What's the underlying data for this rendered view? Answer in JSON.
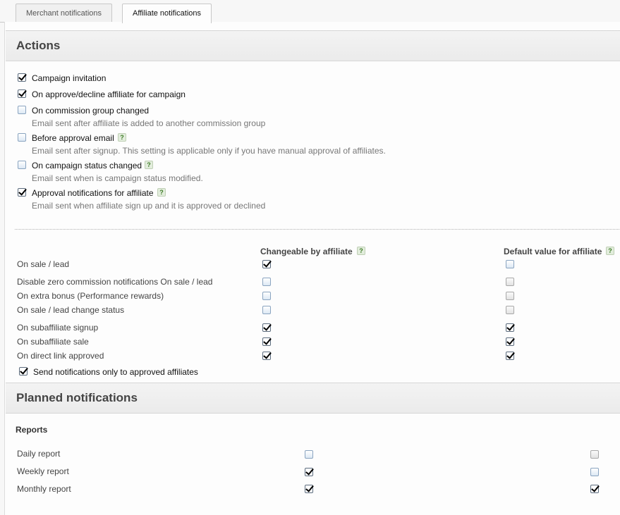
{
  "tabs": [
    {
      "label": "Merchant notifications",
      "active": false
    },
    {
      "label": "Affiliate notifications",
      "active": true
    }
  ],
  "actions": {
    "title": "Actions",
    "items": [
      {
        "label": "Campaign invitation",
        "checked": true,
        "desc": "",
        "help": false
      },
      {
        "label": "On approve/decline affiliate for campaign",
        "checked": true,
        "desc": "",
        "help": false
      },
      {
        "label": "On commission group changed",
        "checked": false,
        "desc": "Email sent after affiliate is added to another commission group",
        "help": false
      },
      {
        "label": "Before approval email",
        "checked": false,
        "desc": "Email sent after signup. This setting is applicable only if you have manual approval of affiliates.",
        "help": true
      },
      {
        "label": "On campaign status changed",
        "checked": false,
        "desc": "Email sent when is campaign status modified.",
        "help": true
      },
      {
        "label": "Approval notifications for affiliate",
        "checked": true,
        "desc": "Email sent when affiliate sign up and it is approved or declined",
        "help": true
      }
    ],
    "help_glyph": "?",
    "columns": {
      "changeable": "Changeable by affiliate",
      "default": "Default value for affiliate"
    },
    "rows": [
      {
        "label": "On sale / lead",
        "changeable": true,
        "default": false,
        "default_disabled": false
      },
      {
        "label": "Disable zero commission notifications On sale / lead",
        "changeable": false,
        "default": false,
        "default_disabled": true
      },
      {
        "label": "On extra bonus (Performance rewards)",
        "changeable": false,
        "default": false,
        "default_disabled": true
      },
      {
        "label": "On sale / lead change status",
        "changeable": false,
        "default": false,
        "default_disabled": true
      },
      {
        "label": "On subaffiliate signup",
        "changeable": true,
        "default": true,
        "default_disabled": false
      },
      {
        "label": "On subaffiliate sale",
        "changeable": true,
        "default": true,
        "default_disabled": false
      },
      {
        "label": "On direct link approved",
        "changeable": true,
        "default": true,
        "default_disabled": false
      }
    ],
    "approved_only": {
      "label": "Send notifications only to approved affiliates",
      "checked": true
    }
  },
  "planned": {
    "title": "Planned notifications",
    "reports_label": "Reports",
    "rows": [
      {
        "label": "Daily report",
        "changeable": false,
        "default": false,
        "default_disabled": true
      },
      {
        "label": "Weekly report",
        "changeable": true,
        "default": false,
        "default_disabled": false
      },
      {
        "label": "Monthly report",
        "changeable": true,
        "default": true,
        "default_disabled": false
      }
    ]
  }
}
